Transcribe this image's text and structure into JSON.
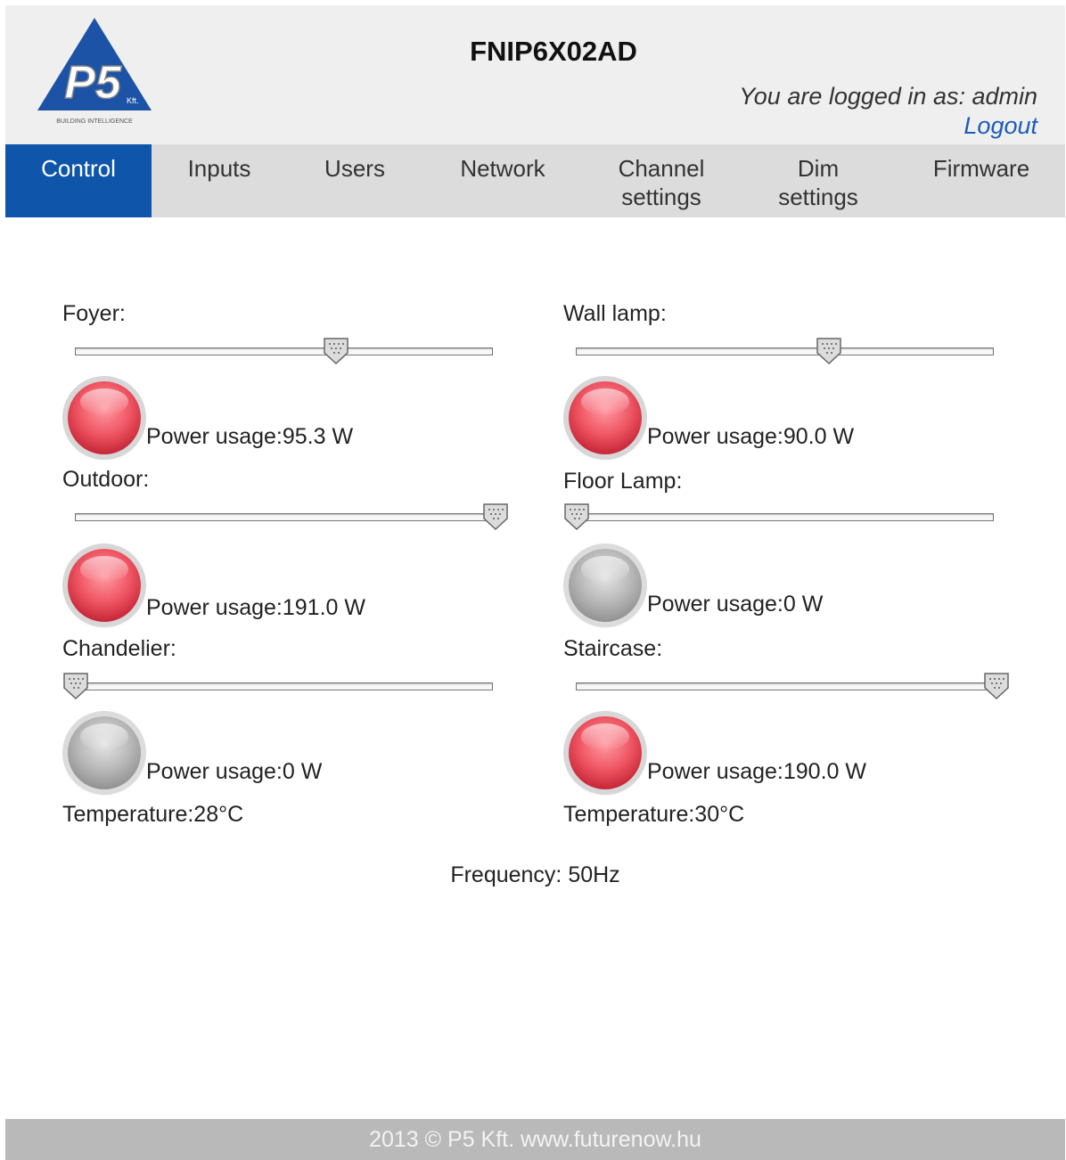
{
  "header": {
    "title": "FNIP6X02AD",
    "logged_in_text": "You are logged in as: admin",
    "logout_label": "Logout",
    "logo_text": "P5",
    "logo_sub": "Kft.",
    "logo_tagline": "BUILDING INTELLIGENCE"
  },
  "nav": {
    "tabs": [
      {
        "label": "Control",
        "line2": ""
      },
      {
        "label": "Inputs",
        "line2": ""
      },
      {
        "label": "Users",
        "line2": ""
      },
      {
        "label": "Network",
        "line2": ""
      },
      {
        "label": "Channel",
        "line2": "settings"
      },
      {
        "label": "Dim",
        "line2": "settings"
      },
      {
        "label": "Firmware",
        "line2": ""
      }
    ],
    "active_tab": "Control"
  },
  "channels": [
    {
      "name": "Foyer:",
      "level_pct": 62,
      "state": "on",
      "power_label": "Power usage:",
      "power_value": "95.3 W"
    },
    {
      "name": "Wall lamp:",
      "level_pct": 60,
      "state": "on",
      "power_label": "Power usage:",
      "power_value": "90.0 W"
    },
    {
      "name": "Outdoor:",
      "level_pct": 100,
      "state": "on",
      "power_label": "Power usage:",
      "power_value": "191.0 W"
    },
    {
      "name": "Floor Lamp:",
      "level_pct": 0,
      "state": "off",
      "power_label": "Power usage:",
      "power_value": "0 W"
    },
    {
      "name": "Chandelier:",
      "level_pct": 0,
      "state": "off",
      "power_label": "Power usage:",
      "power_value": "0 W"
    },
    {
      "name": "Staircase:",
      "level_pct": 100,
      "state": "on",
      "power_label": "Power usage:",
      "power_value": "190.0 W"
    }
  ],
  "temperatures": {
    "left": "Temperature:28°C",
    "right": "Temperature:30°C"
  },
  "frequency": "Frequency: 50Hz",
  "footer": "2013 © P5 Kft.  www.futurenow.hu",
  "colors": {
    "active_tab": "#0f55aa",
    "logout_link": "#1e5bb9",
    "bulb_on": "#ef5563",
    "bulb_off": "#b8b8b8",
    "footer_bg": "#b9b9b9"
  }
}
